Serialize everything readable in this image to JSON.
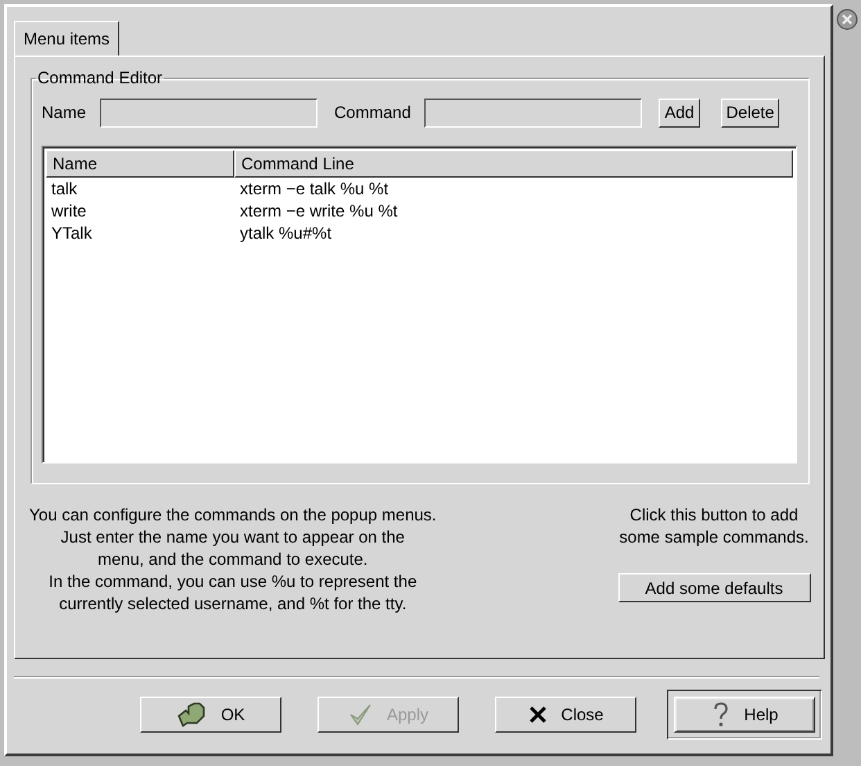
{
  "tabs": [
    {
      "label": "Menu items",
      "selected": true
    }
  ],
  "command_editor": {
    "title": "Command Editor",
    "fields": [
      {
        "label": "Name"
      },
      {
        "label": "Command"
      }
    ],
    "buttons": [
      {
        "label": "Add",
        "disabled": false
      },
      {
        "label": "Delete",
        "disabled": false
      }
    ],
    "table": {
      "columns": [
        "Name",
        "Command Line"
      ],
      "rows": [
        [
          "talk",
          "xterm −e talk %u %t"
        ],
        [
          "write",
          "xterm −e write %u %t"
        ],
        [
          "YTalk",
          "ytalk %u#%t"
        ]
      ]
    }
  },
  "help_text": [
    "You can configure the commands on the popup menus.",
    "Just enter the name you want to appear on the",
    "menu, and the command to execute.",
    "In the command, you can use %u to represent the",
    "currently selected username, and %t for the tty."
  ],
  "defaults": {
    "text": [
      "Click this button to add",
      "some sample commands."
    ],
    "button": "Add some defaults"
  },
  "dialog_buttons": [
    {
      "kind": "ok",
      "label": "OK",
      "disabled": false,
      "default": false
    },
    {
      "kind": "apply",
      "label": "Apply",
      "disabled": true,
      "default": false
    },
    {
      "kind": "close",
      "label": "Close",
      "disabled": false,
      "default": false
    },
    {
      "kind": "help",
      "label": "Help",
      "disabled": false,
      "default": true
    }
  ]
}
